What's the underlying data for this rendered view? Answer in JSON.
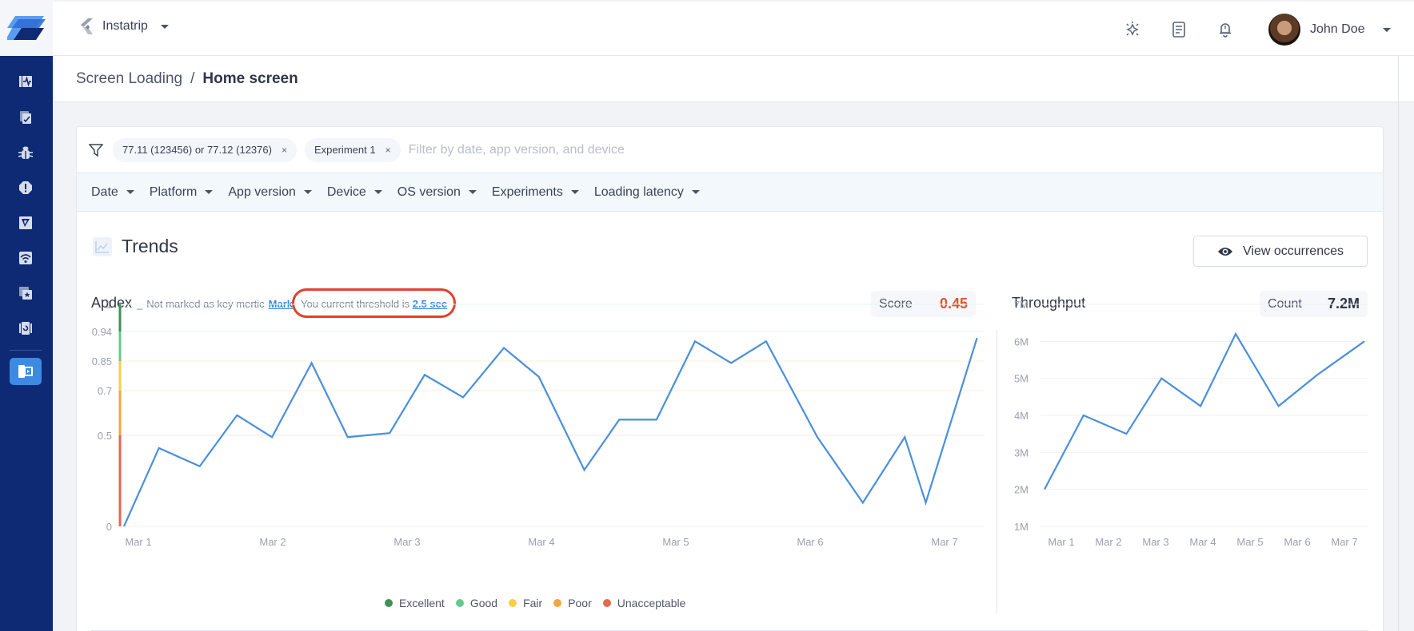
{
  "app": {
    "name": "Instatrip"
  },
  "sidebar": {
    "items": [
      {
        "name": "app-performance",
        "icon": "performance-icon"
      },
      {
        "name": "crash-reports",
        "icon": "document-check-icon"
      },
      {
        "name": "bug-reports",
        "icon": "bug-icon"
      },
      {
        "name": "crashes",
        "icon": "alert-octagon-icon"
      },
      {
        "name": "releases",
        "icon": "rocket-icon"
      },
      {
        "name": "network",
        "icon": "wifi-icon"
      },
      {
        "name": "app-ratings",
        "icon": "star-cards-icon"
      },
      {
        "name": "repro-steps",
        "icon": "rotate-device-icon"
      },
      {
        "name": "screen-loading",
        "icon": "screen-loading-icon",
        "active": true
      }
    ]
  },
  "topbar": {
    "icons": [
      "debug-icon",
      "document-icon",
      "bell-icon"
    ],
    "user": {
      "name": "John Doe"
    }
  },
  "breadcrumb": {
    "parent": "Screen Loading",
    "separator": "/",
    "current": "Home screen"
  },
  "filters": {
    "chips": [
      {
        "label": "77.11 (123456) or 77.12 (12376)",
        "remove": "×"
      },
      {
        "label": "Experiment 1",
        "remove": "×"
      }
    ],
    "placeholder": "Filter by date, app version, and device",
    "dropdowns": [
      "Date",
      "Platform",
      "App version",
      "Device",
      "OS version",
      "Experiments",
      "Loading latency"
    ]
  },
  "trends": {
    "title": "Trends",
    "view_button": "View occurrences"
  },
  "apdex": {
    "title": "Apdex",
    "dash": "_",
    "not_marked": "Not marked as key mertic",
    "mark_link": "Mark",
    "threshold_text": "You current threshold is",
    "threshold_value": "2.5 sec",
    "score_label": "Score",
    "score_value": "0.45",
    "score_color": "#e4502f"
  },
  "throughput": {
    "title": "Throughput",
    "count_label": "Count",
    "count_value": "7.2M"
  },
  "legend": [
    {
      "label": "Excellent",
      "color": "#3e9152"
    },
    {
      "label": "Good",
      "color": "#66c98a"
    },
    {
      "label": "Fair",
      "color": "#f7cd4b"
    },
    {
      "label": "Poor",
      "color": "#f2a442"
    },
    {
      "label": "Unacceptable",
      "color": "#e5694e"
    }
  ],
  "chart_data": [
    {
      "type": "line",
      "title": "Apdex",
      "xlabel": "",
      "ylabel": "",
      "x_ticks": [
        "Mar 1",
        "Mar 2",
        "Mar 3",
        "Mar 4",
        "Mar 5",
        "Mar 6",
        "Mar 7"
      ],
      "y_ticks": [
        0,
        0.5,
        0.7,
        0.85,
        0.94,
        1
      ],
      "ylim": [
        0,
        1
      ],
      "grid": true,
      "legend_position": "bottom-center",
      "bands": [
        {
          "label": "Unacceptable",
          "from": 0,
          "to": 0.5,
          "color": "#e5694e"
        },
        {
          "label": "Poor",
          "from": 0.5,
          "to": 0.7,
          "color": "#f2a442"
        },
        {
          "label": "Fair",
          "from": 0.7,
          "to": 0.85,
          "color": "#f7cd4b"
        },
        {
          "label": "Good",
          "from": 0.85,
          "to": 0.94,
          "color": "#66c98a"
        },
        {
          "label": "Excellent",
          "from": 0.94,
          "to": 1,
          "color": "#3e9152"
        }
      ],
      "series": [
        {
          "name": "Apdex",
          "color": "#4a8fdb",
          "x": [
            0.0,
            0.3,
            0.65,
            0.97,
            1.27,
            1.61,
            1.92,
            2.28,
            2.58,
            2.91,
            3.26,
            3.56,
            3.95,
            4.25,
            4.57,
            4.9,
            5.21,
            5.51,
            5.95,
            6.34,
            6.7,
            6.88,
            7.32
          ],
          "values": [
            0.0,
            0.43,
            0.33,
            0.59,
            0.49,
            0.84,
            0.49,
            0.51,
            0.78,
            0.67,
            0.89,
            0.77,
            0.31,
            0.57,
            0.57,
            0.91,
            0.84,
            0.91,
            0.49,
            0.13,
            0.49,
            0.13,
            0.92
          ]
        }
      ]
    },
    {
      "type": "line",
      "title": "Throughput",
      "xlabel": "",
      "ylabel": "",
      "categories": [
        "Mar 1",
        "Mar 2",
        "Mar 3",
        "Mar 4",
        "Mar 5",
        "Mar 6",
        "Mar 7"
      ],
      "y_ticks": [
        "1M",
        "2M",
        "3M",
        "4M",
        "5M",
        "6M",
        "7M"
      ],
      "ylim": [
        1,
        7
      ],
      "grid": true,
      "series": [
        {
          "name": "Throughput (M)",
          "color": "#4a8fdb",
          "x": [
            0,
            0.5,
            1.05,
            1.5,
            2.0,
            2.45,
            3.0,
            3.5,
            4.1
          ],
          "values": [
            2.0,
            4.0,
            3.5,
            5.0,
            4.25,
            6.2,
            4.25,
            5.1,
            6.0
          ]
        }
      ]
    }
  ]
}
